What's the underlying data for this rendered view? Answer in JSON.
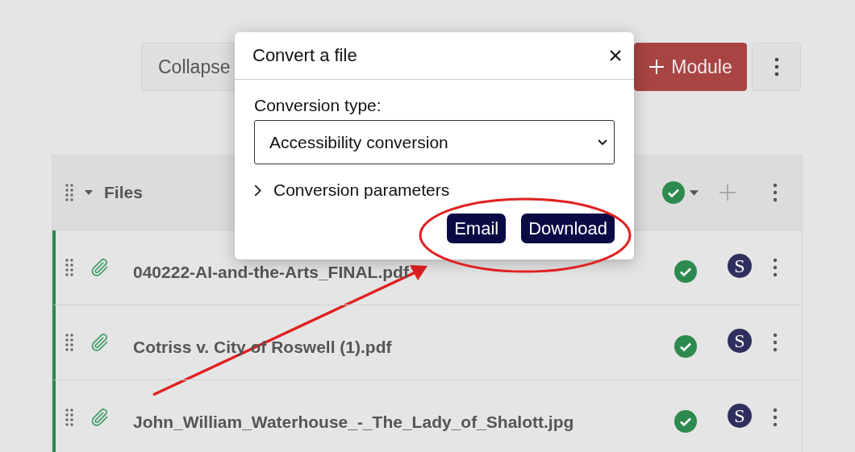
{
  "toolbar": {
    "collapse_button": "Collapse",
    "module_button": "Module"
  },
  "module": {
    "title": "Files",
    "published": true,
    "items": [
      {
        "name": "040222-AI-and-the-Arts_FINAL.pdf",
        "published": true,
        "avatar": "S"
      },
      {
        "name": "Cotriss v. City of Roswell (1).pdf",
        "published": true,
        "avatar": "S"
      },
      {
        "name": "John_William_Waterhouse_-_The_Lady_of_Shalott.jpg",
        "published": true,
        "avatar": "S"
      }
    ]
  },
  "dialog": {
    "title": "Convert a file",
    "field_label": "Conversion type:",
    "select_value": "Accessibility conversion",
    "parameters": {
      "label": "Conversion parameters",
      "expanded": false
    },
    "buttons": [
      "Email",
      "Download"
    ]
  }
}
